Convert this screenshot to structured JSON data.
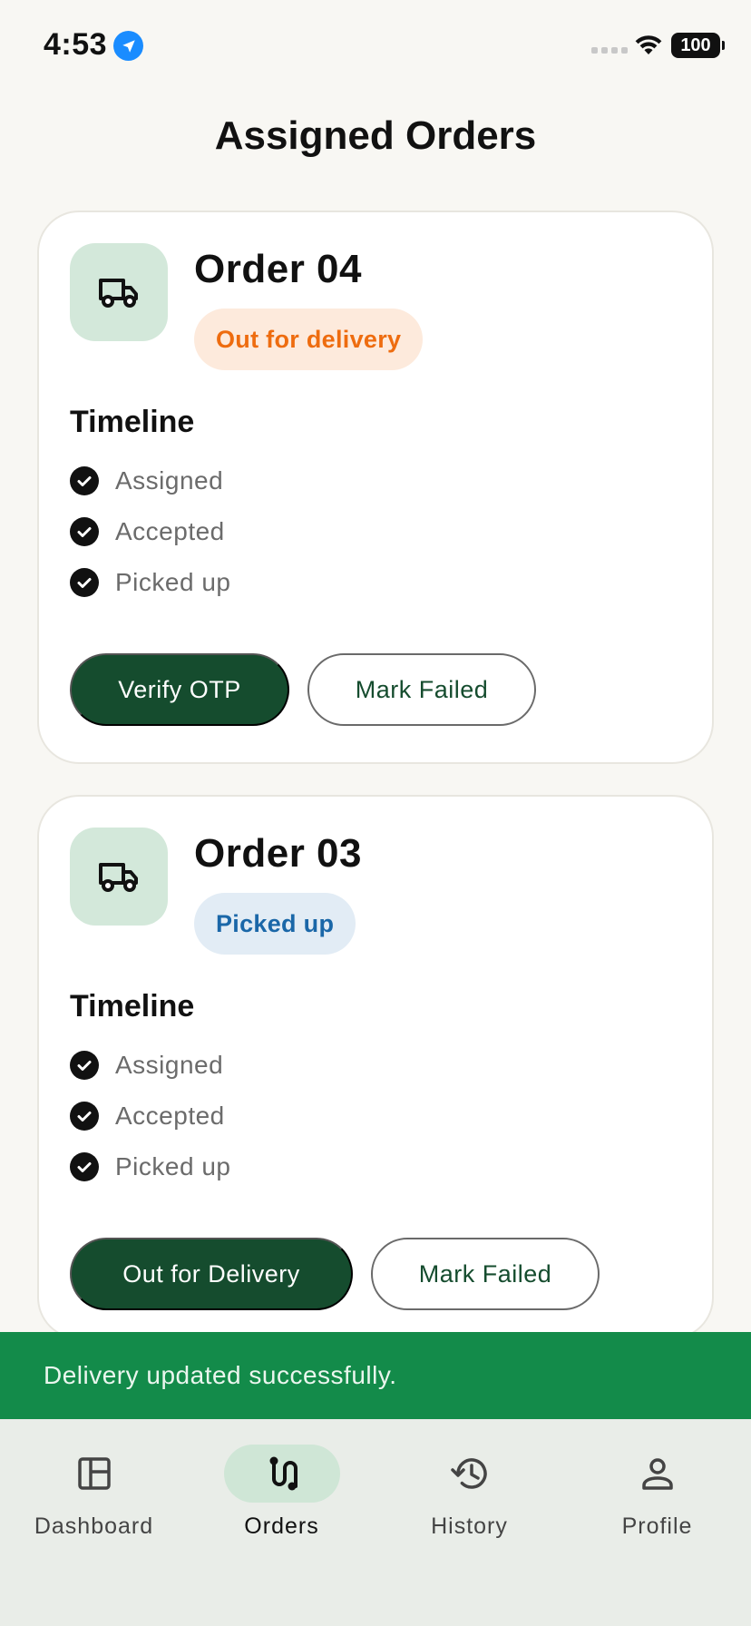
{
  "status_bar": {
    "time": "4:53",
    "battery": "100",
    "icons": [
      "location-arrow-icon",
      "signal-icon",
      "wifi-icon",
      "battery-icon"
    ]
  },
  "page": {
    "title": "Assigned Orders"
  },
  "orders": [
    {
      "title": "Order 04",
      "icon": "truck-icon",
      "status": "Out for delivery",
      "status_color": "#ee6c0f",
      "timeline_title": "Timeline",
      "timeline": [
        "Assigned",
        "Accepted",
        "Picked up"
      ],
      "primary_action": "Verify OTP",
      "secondary_action": "Mark Failed"
    },
    {
      "title": "Order 03",
      "icon": "truck-icon",
      "status": "Picked up",
      "status_color": "#1a67a8",
      "timeline_title": "Timeline",
      "timeline": [
        "Assigned",
        "Accepted",
        "Picked up"
      ],
      "primary_action": "Out for Delivery",
      "secondary_action": "Mark Failed"
    }
  ],
  "toast": {
    "message": "Delivery updated successfully."
  },
  "nav": {
    "items": [
      {
        "label": "Dashboard",
        "icon": "dashboard-icon",
        "active": false
      },
      {
        "label": "Orders",
        "icon": "route-icon",
        "active": true
      },
      {
        "label": "History",
        "icon": "history-icon",
        "active": false
      },
      {
        "label": "Profile",
        "icon": "profile-icon",
        "active": false
      }
    ]
  },
  "colors": {
    "primary": "#154c2e",
    "toast": "#138b4a",
    "background": "#f8f7f3",
    "nav_background": "#e9ede8"
  }
}
